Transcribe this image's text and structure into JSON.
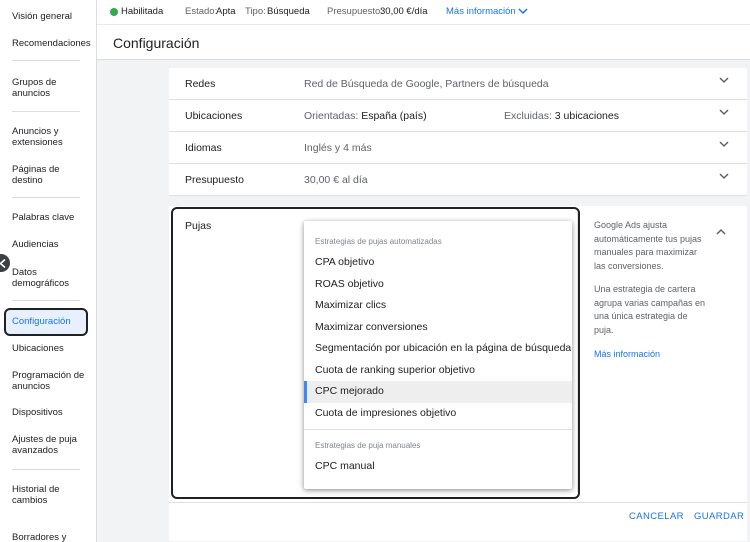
{
  "sidebar": {
    "items": [
      {
        "label": "Visión general"
      },
      {
        "label": "Recomendaciones"
      },
      {
        "label": "Grupos de anuncios"
      },
      {
        "label": "Anuncios y extensiones"
      },
      {
        "label": "Páginas de destino"
      },
      {
        "label": "Palabras clave"
      },
      {
        "label": "Audiencias"
      },
      {
        "label": "Datos demográficos"
      },
      {
        "label": "Configuración"
      },
      {
        "label": "Ubicaciones"
      },
      {
        "label": "Programación de anuncios"
      },
      {
        "label": "Dispositivos"
      },
      {
        "label": "Ajustes de puja avanzados"
      },
      {
        "label": "Historial de cambios"
      },
      {
        "label": "Borradores y"
      }
    ],
    "active_item": "Configuración",
    "collapse_icon": "chevron-left-icon"
  },
  "status_bar": {
    "status": "Habilitada",
    "estado_label": "Estado:",
    "estado_value": "Apta",
    "tipo_label": "Tipo:",
    "tipo_value": "Búsqueda",
    "presupuesto_label": "Presupuesto:",
    "presupuesto_value": "30,00 €/día",
    "more_info": "Más información",
    "status_color": "#34a853"
  },
  "page_title": "Configuración",
  "settings": {
    "redes": {
      "name": "Redes",
      "value": "Red de Búsqueda de Google, Partners de búsqueda"
    },
    "ubicaciones": {
      "name": "Ubicaciones",
      "targeted_label": "Orientadas:",
      "targeted_value": "España (país)",
      "excluded_label": "Excluidas:",
      "excluded_value": "3 ubicaciones"
    },
    "idiomas": {
      "name": "Idiomas",
      "value": "Inglés y 4 más"
    },
    "presupuesto": {
      "name": "Presupuesto",
      "value": "30,00 € al día"
    }
  },
  "pujas": {
    "label": "Pujas",
    "menu": {
      "group_auto": "Estrategias de pujas automatizadas",
      "auto_options": [
        "CPA objetivo",
        "ROAS objetivo",
        "Maximizar clics",
        "Maximizar conversiones",
        "Segmentación por ubicación en la página de búsqueda",
        "Cuota de ranking superior objetivo",
        "CPC mejorado",
        "Cuota de impresiones objetivo"
      ],
      "selected": "CPC mejorado",
      "group_manual": "Estrategias de puja manuales",
      "manual_options": [
        "CPC manual"
      ]
    },
    "help_text_1": "Google Ads ajusta automáticamente tus pujas manuales para maximizar las conversiones.",
    "help_text_2": "Una estrategia de cartera agrupa varias campañas en una única estrategia de puja.",
    "help_link": "Más información"
  },
  "footer": {
    "cancel": "CANCELAR",
    "save": "GUARDAR"
  },
  "colors": {
    "accent": "#1a73e8",
    "selected_bar": "#4285f4"
  }
}
